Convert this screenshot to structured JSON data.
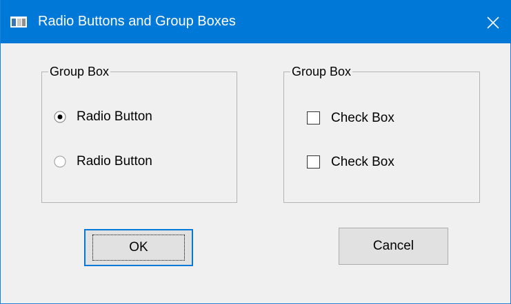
{
  "window": {
    "title": "Radio Buttons and Group Boxes",
    "icon": "app-window-icon",
    "close_icon": "close-icon",
    "accent": "#0078d7"
  },
  "group_left": {
    "title": "Group Box",
    "options": [
      {
        "label": "Radio Button",
        "checked": true
      },
      {
        "label": "Radio Button",
        "checked": false
      }
    ]
  },
  "group_right": {
    "title": "Group Box",
    "options": [
      {
        "label": "Check Box",
        "checked": false
      },
      {
        "label": "Check Box",
        "checked": false
      }
    ]
  },
  "buttons": {
    "ok": "OK",
    "cancel": "Cancel"
  }
}
